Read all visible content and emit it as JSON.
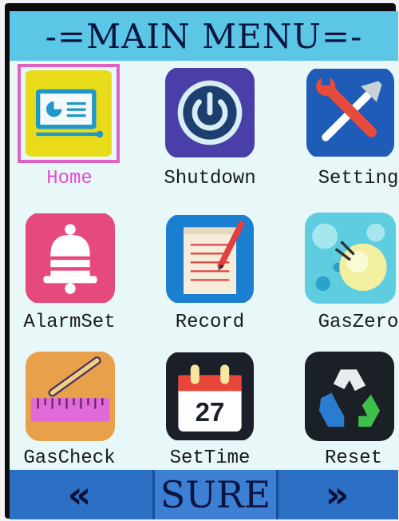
{
  "title": "-=MAIN MENU=-",
  "menu": [
    {
      "label": "Home",
      "icon": "home-monitor-icon",
      "selected": true
    },
    {
      "label": "Shutdown",
      "icon": "power-icon",
      "selected": false
    },
    {
      "label": "Setting",
      "icon": "wrench-screwdriver-icon",
      "selected": false
    },
    {
      "label": "AlarmSet",
      "icon": "bell-icon",
      "selected": false
    },
    {
      "label": "Record",
      "icon": "notepad-pencil-icon",
      "selected": false
    },
    {
      "label": "GasZero",
      "icon": "gas-bulb-icon",
      "selected": false
    },
    {
      "label": "GasCheck",
      "icon": "ruler-pencil-icon",
      "selected": false
    },
    {
      "label": "SetTime",
      "icon": "calendar-icon",
      "selected": false
    },
    {
      "label": "Reset",
      "icon": "recycle-icon",
      "selected": false
    }
  ],
  "calendar_day": "27",
  "buttons": {
    "prev": "«",
    "sure": "SURE",
    "next": "»"
  },
  "colors": {
    "title_bar": "#5bc6e6",
    "bottom_bar": "#2c70c6",
    "selected_border": "#e060c4",
    "selected_label": "#e14fd0"
  }
}
